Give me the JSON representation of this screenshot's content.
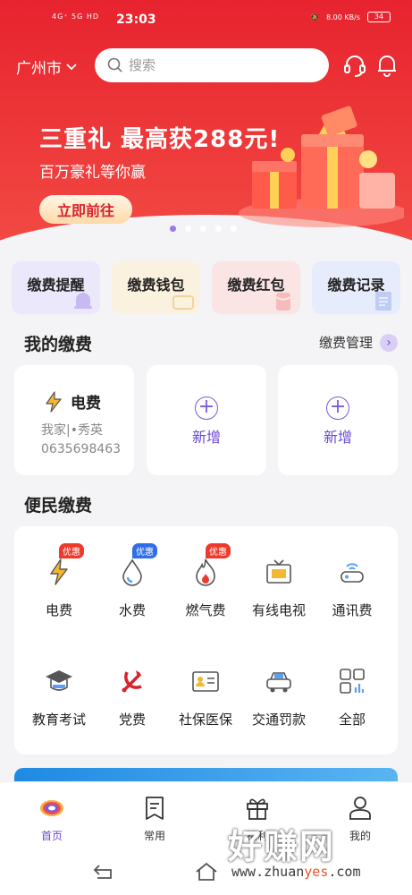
{
  "status": {
    "network": "4G⁺ 5G HD",
    "time": "23:03",
    "speed": "8.00 KB/s",
    "battery": "34"
  },
  "header": {
    "city": "广州市",
    "search_placeholder": "搜索"
  },
  "banner": {
    "title": "三重礼 最高获288元!",
    "subtitle": "百万豪礼等你赢",
    "button": "立即前往",
    "dot_count": 5,
    "active_dot": 0
  },
  "quick_cards": [
    {
      "label": "缴费提醒",
      "bg": "#ece8fb"
    },
    {
      "label": "缴费钱包",
      "bg": "#fbf1df"
    },
    {
      "label": "缴费红包",
      "bg": "#fbe4e4"
    },
    {
      "label": "缴费记录",
      "bg": "#e6ecfb"
    }
  ],
  "my_bills": {
    "title": "我的缴费",
    "manage": "缴费管理",
    "bill": {
      "name": "电费",
      "owner": "我家|•秀英",
      "account": "0635698463"
    },
    "add_labels": [
      "新增",
      "新增"
    ]
  },
  "services": {
    "title": "便民缴费",
    "items": [
      {
        "label": "电费",
        "tag": "优惠",
        "tag_color": "red"
      },
      {
        "label": "水费",
        "tag": "优惠",
        "tag_color": "blue"
      },
      {
        "label": "燃气费",
        "tag": "优惠",
        "tag_color": "red"
      },
      {
        "label": "有线电视",
        "tag": ""
      },
      {
        "label": "通讯费",
        "tag": ""
      },
      {
        "label": "教育考试",
        "tag": ""
      },
      {
        "label": "党费",
        "tag": ""
      },
      {
        "label": "社保医保",
        "tag": ""
      },
      {
        "label": "交通罚款",
        "tag": ""
      },
      {
        "label": "全部",
        "tag": ""
      }
    ]
  },
  "tabs": [
    {
      "label": "首页",
      "active": true
    },
    {
      "label": "常用",
      "active": false
    },
    {
      "label": "福利",
      "active": false
    },
    {
      "label": "我的",
      "active": false
    }
  ],
  "watermark": {
    "big": "好赚网",
    "small_prefix": "www.zhuan",
    "small_highlight": "yes",
    "small_suffix": ".com"
  },
  "colors": {
    "brand_red": "#e7232f",
    "accent_purple": "#6b4ad1"
  }
}
